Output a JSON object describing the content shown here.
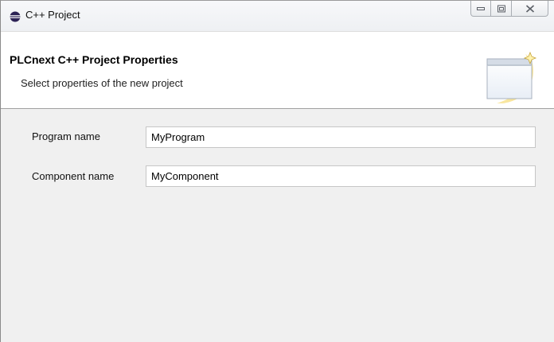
{
  "window": {
    "title": "C++ Project",
    "title_icon": "eclipse-icon",
    "controls": [
      "minimize-icon",
      "restore-icon",
      "close-icon"
    ]
  },
  "header": {
    "title": "PLCnext C++ Project Properties",
    "subtitle": "Select properties of the new project",
    "graphic": "new-project-wizard-icon"
  },
  "form": {
    "program_name": {
      "label": "Program name",
      "value": "MyProgram"
    },
    "component_name": {
      "label": "Component name",
      "value": "MyComponent"
    }
  },
  "colors": {
    "body_background": "#f0f0f0",
    "header_background": "#ffffff",
    "input_border": "#c6c6c6"
  }
}
